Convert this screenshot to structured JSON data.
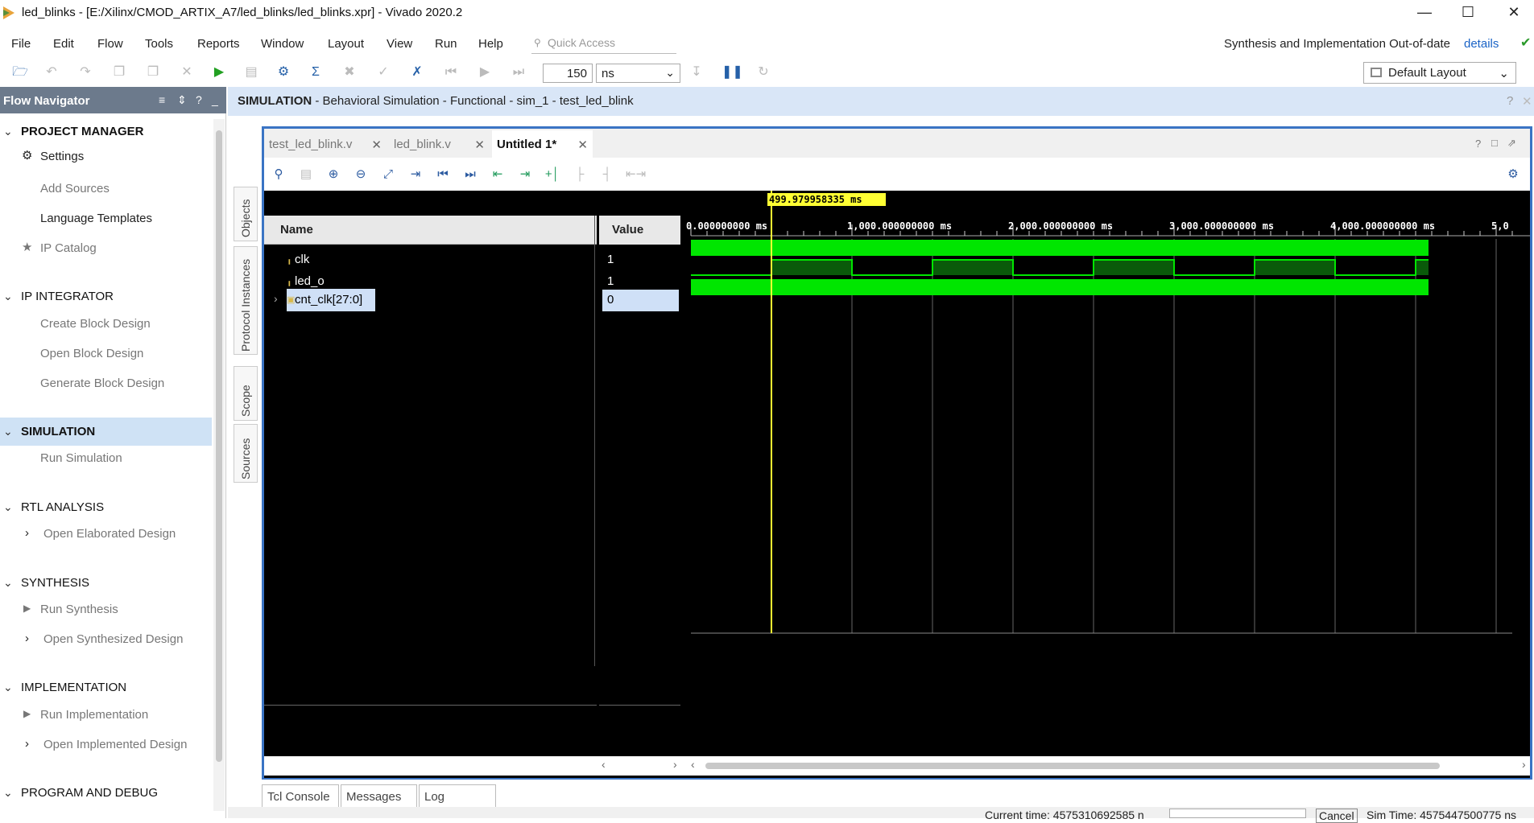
{
  "window": {
    "title": "led_blinks - [E:/Xilinx/CMOD_ARTIX_A7/led_blinks/led_blinks.xpr] - Vivado 2020.2",
    "minimize": "—",
    "maximize": "☐",
    "close": "✕"
  },
  "menu": {
    "items": [
      "File",
      "Edit",
      "Flow",
      "Tools",
      "Reports",
      "Window",
      "Layout",
      "View",
      "Run",
      "Help"
    ],
    "quick_access_placeholder": "Quick Access",
    "status_message": "Synthesis and Implementation Out-of-date",
    "details_link": "details"
  },
  "toolbar": {
    "sim_time_value": "150",
    "sim_time_unit": "ns",
    "layout": "Default Layout"
  },
  "flow_navigator": {
    "title": "Flow Navigator",
    "sections": {
      "project_manager": {
        "label": "PROJECT MANAGER",
        "items": [
          "Settings",
          "Add Sources",
          "Language Templates",
          "IP Catalog"
        ]
      },
      "ip_integrator": {
        "label": "IP INTEGRATOR",
        "items": [
          "Create Block Design",
          "Open Block Design",
          "Generate Block Design"
        ]
      },
      "simulation": {
        "label": "SIMULATION",
        "items": [
          "Run Simulation"
        ]
      },
      "rtl_analysis": {
        "label": "RTL ANALYSIS",
        "items": [
          "Open Elaborated Design"
        ]
      },
      "synthesis": {
        "label": "SYNTHESIS",
        "items": [
          "Run Synthesis",
          "Open Synthesized Design"
        ]
      },
      "implementation": {
        "label": "IMPLEMENTATION",
        "items": [
          "Run Implementation",
          "Open Implemented Design"
        ]
      },
      "program_debug": {
        "label": "PROGRAM AND DEBUG"
      }
    }
  },
  "sim_header": {
    "title": "SIMULATION",
    "subtitle": " - Behavioral Simulation - Functional - sim_1 - test_led_blink"
  },
  "side_tabs": [
    "Objects",
    "Protocol Instances",
    "Scope",
    "Sources"
  ],
  "doc_tabs": [
    "test_led_blink.v",
    "led_blink.v",
    "Untitled 1*"
  ],
  "waveform": {
    "name_header": "Name",
    "value_header": "Value",
    "cursor_label": "499.979958335 ms",
    "signals": [
      {
        "name": "clk",
        "value": "1"
      },
      {
        "name": "led_o",
        "value": "1"
      },
      {
        "name": "cnt_clk[27:0]",
        "value": "0"
      }
    ],
    "timeline_labels": [
      "0.000000000 ms",
      "1,000.000000000 ms",
      "2,000.000000000 ms",
      "3,000.000000000 ms",
      "4,000.000000000 ms",
      "5,0"
    ],
    "cursor_ms": 499.979958335,
    "visible_end_ms": 4580,
    "led_toggle_ms": 500
  },
  "bottom_tabs": [
    "Tcl Console",
    "Messages",
    "Log"
  ],
  "status_bar": {
    "current_time": "Current time: 4575310692585 n",
    "cancel": "Cancel",
    "sim_time": "Sim Time: 4575447500775 ns"
  }
}
